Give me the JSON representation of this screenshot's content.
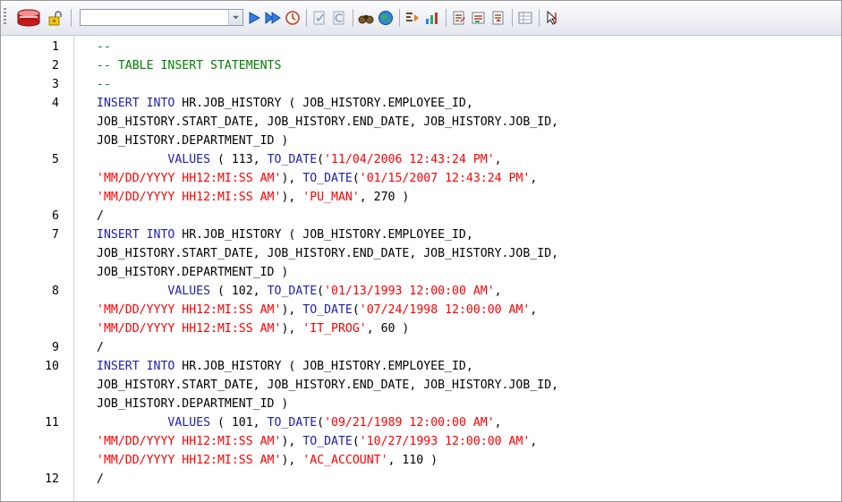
{
  "toolbar": {
    "sql_history_value": "",
    "icons": [
      "connect-db-icon",
      "lock-icon",
      "dropdown-arrow-icon",
      "execute-icon",
      "execute-script-icon",
      "explain-plan-icon",
      "commit-icon",
      "rollback-icon",
      "find-icon",
      "globe-icon",
      "format-sql-icon",
      "chart-icon",
      "edit-icon",
      "save-icon",
      "open-icon",
      "grid-icon",
      "cursor-icon"
    ]
  },
  "colors": {
    "keyword": "#1e1eb4",
    "string": "#ff0000",
    "comment": "#008000",
    "plain": "#000000"
  },
  "editor": {
    "lines": [
      {
        "number": "1",
        "rows": [
          [
            {
              "t": "--",
              "c": "comment"
            }
          ]
        ]
      },
      {
        "number": "2",
        "rows": [
          [
            {
              "t": "-- TABLE INSERT STATEMENTS",
              "c": "comment"
            }
          ]
        ]
      },
      {
        "number": "3",
        "rows": [
          [
            {
              "t": "--",
              "c": "comment"
            }
          ]
        ]
      },
      {
        "number": "4",
        "rows": [
          [
            {
              "t": "INSERT INTO",
              "c": "keyword"
            },
            {
              "t": " HR.JOB_HISTORY ( JOB_HISTORY.EMPLOYEE_ID,",
              "c": "plain"
            }
          ],
          [
            {
              "t": "JOB_HISTORY.START_DATE, JOB_HISTORY.END_DATE, JOB_HISTORY.JOB_ID,",
              "c": "plain"
            }
          ],
          [
            {
              "t": "JOB_HISTORY.DEPARTMENT_ID )",
              "c": "plain"
            }
          ]
        ]
      },
      {
        "number": "5",
        "rows": [
          [
            {
              "t": "          ",
              "c": "plain"
            },
            {
              "t": "VALUES",
              "c": "keyword"
            },
            {
              "t": " ( 113, ",
              "c": "plain"
            },
            {
              "t": "TO_DATE",
              "c": "keyword"
            },
            {
              "t": "(",
              "c": "plain"
            },
            {
              "t": "'11/04/2006 12:43:24 PM'",
              "c": "string"
            },
            {
              "t": ",",
              "c": "plain"
            }
          ],
          [
            {
              "t": "'MM/DD/YYYY HH12:MI:SS AM'",
              "c": "string"
            },
            {
              "t": "), ",
              "c": "plain"
            },
            {
              "t": "TO_DATE",
              "c": "keyword"
            },
            {
              "t": "(",
              "c": "plain"
            },
            {
              "t": "'01/15/2007 12:43:24 PM'",
              "c": "string"
            },
            {
              "t": ",",
              "c": "plain"
            }
          ],
          [
            {
              "t": "'MM/DD/YYYY HH12:MI:SS AM'",
              "c": "string"
            },
            {
              "t": "), ",
              "c": "plain"
            },
            {
              "t": "'PU_MAN'",
              "c": "string"
            },
            {
              "t": ", 270 )",
              "c": "plain"
            }
          ]
        ]
      },
      {
        "number": "6",
        "rows": [
          [
            {
              "t": "/",
              "c": "plain"
            }
          ]
        ]
      },
      {
        "number": "7",
        "rows": [
          [
            {
              "t": "INSERT INTO",
              "c": "keyword"
            },
            {
              "t": " HR.JOB_HISTORY ( JOB_HISTORY.EMPLOYEE_ID,",
              "c": "plain"
            }
          ],
          [
            {
              "t": "JOB_HISTORY.START_DATE, JOB_HISTORY.END_DATE, JOB_HISTORY.JOB_ID,",
              "c": "plain"
            }
          ],
          [
            {
              "t": "JOB_HISTORY.DEPARTMENT_ID )",
              "c": "plain"
            }
          ]
        ]
      },
      {
        "number": "8",
        "rows": [
          [
            {
              "t": "          ",
              "c": "plain"
            },
            {
              "t": "VALUES",
              "c": "keyword"
            },
            {
              "t": " ( 102, ",
              "c": "plain"
            },
            {
              "t": "TO_DATE",
              "c": "keyword"
            },
            {
              "t": "(",
              "c": "plain"
            },
            {
              "t": "'01/13/1993 12:00:00 AM'",
              "c": "string"
            },
            {
              "t": ",",
              "c": "plain"
            }
          ],
          [
            {
              "t": "'MM/DD/YYYY HH12:MI:SS AM'",
              "c": "string"
            },
            {
              "t": "), ",
              "c": "plain"
            },
            {
              "t": "TO_DATE",
              "c": "keyword"
            },
            {
              "t": "(",
              "c": "plain"
            },
            {
              "t": "'07/24/1998 12:00:00 AM'",
              "c": "string"
            },
            {
              "t": ",",
              "c": "plain"
            }
          ],
          [
            {
              "t": "'MM/DD/YYYY HH12:MI:SS AM'",
              "c": "string"
            },
            {
              "t": "), ",
              "c": "plain"
            },
            {
              "t": "'IT_PROG'",
              "c": "string"
            },
            {
              "t": ", 60 )",
              "c": "plain"
            }
          ]
        ]
      },
      {
        "number": "9",
        "rows": [
          [
            {
              "t": "/",
              "c": "plain"
            }
          ]
        ]
      },
      {
        "number": "10",
        "rows": [
          [
            {
              "t": "INSERT INTO",
              "c": "keyword"
            },
            {
              "t": " HR.JOB_HISTORY ( JOB_HISTORY.EMPLOYEE_ID,",
              "c": "plain"
            }
          ],
          [
            {
              "t": "JOB_HISTORY.START_DATE, JOB_HISTORY.END_DATE, JOB_HISTORY.JOB_ID,",
              "c": "plain"
            }
          ],
          [
            {
              "t": "JOB_HISTORY.DEPARTMENT_ID )",
              "c": "plain"
            }
          ]
        ]
      },
      {
        "number": "11",
        "rows": [
          [
            {
              "t": "          ",
              "c": "plain"
            },
            {
              "t": "VALUES",
              "c": "keyword"
            },
            {
              "t": " ( 101, ",
              "c": "plain"
            },
            {
              "t": "TO_DATE",
              "c": "keyword"
            },
            {
              "t": "(",
              "c": "plain"
            },
            {
              "t": "'09/21/1989 12:00:00 AM'",
              "c": "string"
            },
            {
              "t": ",",
              "c": "plain"
            }
          ],
          [
            {
              "t": "'MM/DD/YYYY HH12:MI:SS AM'",
              "c": "string"
            },
            {
              "t": "), ",
              "c": "plain"
            },
            {
              "t": "TO_DATE",
              "c": "keyword"
            },
            {
              "t": "(",
              "c": "plain"
            },
            {
              "t": "'10/27/1993 12:00:00 AM'",
              "c": "string"
            },
            {
              "t": ",",
              "c": "plain"
            }
          ],
          [
            {
              "t": "'MM/DD/YYYY HH12:MI:SS AM'",
              "c": "string"
            },
            {
              "t": "), ",
              "c": "plain"
            },
            {
              "t": "'AC_ACCOUNT'",
              "c": "string"
            },
            {
              "t": ", 110 )",
              "c": "plain"
            }
          ]
        ]
      },
      {
        "number": "12",
        "rows": [
          [
            {
              "t": "/",
              "c": "plain"
            }
          ]
        ]
      }
    ]
  }
}
